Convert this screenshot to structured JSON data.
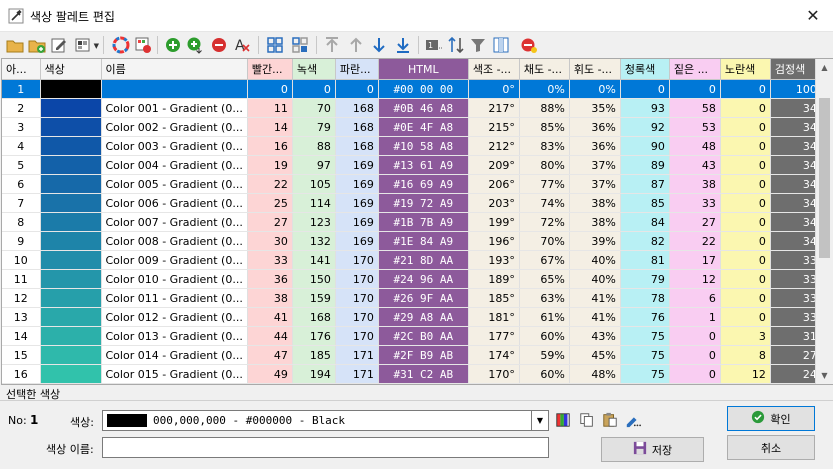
{
  "window": {
    "title": "색상 팔레트 편집"
  },
  "toolbar": {
    "icons": [
      "open-folder-icon",
      "add-folder-icon",
      "edit-palette-icon",
      "palette-menu-icon",
      "color-wheel-icon",
      "palette-settings-icon",
      "add-color-icon",
      "add-after-icon",
      "remove-color-icon",
      "clear-format-icon",
      "grid-view-icon",
      "grid-select-icon",
      "move-top-icon",
      "move-up-icon",
      "move-down-icon",
      "move-bottom-icon",
      "numbering-icon",
      "sort-icon",
      "filter-icon",
      "columns-icon",
      "stop-icon"
    ]
  },
  "grid": {
    "columns": {
      "index": "아...",
      "swatch": "색상",
      "name": "이름",
      "r": "빨간...",
      "g": "녹색",
      "b": "파란...",
      "html": "HTML",
      "hue": "색조 -...",
      "sat": "채도 -...",
      "lum": "휘도 -...",
      "c": "청록색",
      "m": "짙은 ...",
      "y": "노란색",
      "k": "검정색"
    },
    "rows": [
      {
        "i": "1",
        "name": "",
        "r": "0",
        "g": "0",
        "b": "0",
        "html": "#00 00 00",
        "hue": "0°",
        "sat": "0%",
        "lum": "0%",
        "c": "0",
        "m": "0",
        "y": "0",
        "k": "100",
        "color": "#000000"
      },
      {
        "i": "2",
        "name": "Color 001 - Gradient (0...",
        "r": "11",
        "g": "70",
        "b": "168",
        "html": "#0B 46 A8",
        "hue": "217°",
        "sat": "88%",
        "lum": "35%",
        "c": "93",
        "m": "58",
        "y": "0",
        "k": "34",
        "color": "#0B46A8"
      },
      {
        "i": "3",
        "name": "Color 002 - Gradient (0...",
        "r": "14",
        "g": "79",
        "b": "168",
        "html": "#0E 4F A8",
        "hue": "215°",
        "sat": "85%",
        "lum": "36%",
        "c": "92",
        "m": "53",
        "y": "0",
        "k": "34",
        "color": "#0E4FA8"
      },
      {
        "i": "4",
        "name": "Color 003 - Gradient (0...",
        "r": "16",
        "g": "88",
        "b": "168",
        "html": "#10 58 A8",
        "hue": "212°",
        "sat": "83%",
        "lum": "36%",
        "c": "90",
        "m": "48",
        "y": "0",
        "k": "34",
        "color": "#1058A8"
      },
      {
        "i": "5",
        "name": "Color 004 - Gradient (0...",
        "r": "19",
        "g": "97",
        "b": "169",
        "html": "#13 61 A9",
        "hue": "209°",
        "sat": "80%",
        "lum": "37%",
        "c": "89",
        "m": "43",
        "y": "0",
        "k": "34",
        "color": "#1361A9"
      },
      {
        "i": "6",
        "name": "Color 005 - Gradient (0...",
        "r": "22",
        "g": "105",
        "b": "169",
        "html": "#16 69 A9",
        "hue": "206°",
        "sat": "77%",
        "lum": "37%",
        "c": "87",
        "m": "38",
        "y": "0",
        "k": "34",
        "color": "#1669A9"
      },
      {
        "i": "7",
        "name": "Color 006 - Gradient (0...",
        "r": "25",
        "g": "114",
        "b": "169",
        "html": "#19 72 A9",
        "hue": "203°",
        "sat": "74%",
        "lum": "38%",
        "c": "85",
        "m": "33",
        "y": "0",
        "k": "34",
        "color": "#1972A9"
      },
      {
        "i": "8",
        "name": "Color 007 - Gradient (0...",
        "r": "27",
        "g": "123",
        "b": "169",
        "html": "#1B 7B A9",
        "hue": "199°",
        "sat": "72%",
        "lum": "38%",
        "c": "84",
        "m": "27",
        "y": "0",
        "k": "34",
        "color": "#1B7BA9"
      },
      {
        "i": "9",
        "name": "Color 008 - Gradient (0...",
        "r": "30",
        "g": "132",
        "b": "169",
        "html": "#1E 84 A9",
        "hue": "196°",
        "sat": "70%",
        "lum": "39%",
        "c": "82",
        "m": "22",
        "y": "0",
        "k": "34",
        "color": "#1E84A9"
      },
      {
        "i": "10",
        "name": "Color 009 - Gradient (0...",
        "r": "33",
        "g": "141",
        "b": "170",
        "html": "#21 8D AA",
        "hue": "193°",
        "sat": "67%",
        "lum": "40%",
        "c": "81",
        "m": "17",
        "y": "0",
        "k": "33",
        "color": "#218DAA"
      },
      {
        "i": "11",
        "name": "Color 010 - Gradient (0...",
        "r": "36",
        "g": "150",
        "b": "170",
        "html": "#24 96 AA",
        "hue": "189°",
        "sat": "65%",
        "lum": "40%",
        "c": "79",
        "m": "12",
        "y": "0",
        "k": "33",
        "color": "#2496AA"
      },
      {
        "i": "12",
        "name": "Color 011 - Gradient (0...",
        "r": "38",
        "g": "159",
        "b": "170",
        "html": "#26 9F AA",
        "hue": "185°",
        "sat": "63%",
        "lum": "41%",
        "c": "78",
        "m": "6",
        "y": "0",
        "k": "33",
        "color": "#269FAA"
      },
      {
        "i": "13",
        "name": "Color 012 - Gradient (0...",
        "r": "41",
        "g": "168",
        "b": "170",
        "html": "#29 A8 AA",
        "hue": "181°",
        "sat": "61%",
        "lum": "41%",
        "c": "76",
        "m": "1",
        "y": "0",
        "k": "33",
        "color": "#29A8AA"
      },
      {
        "i": "14",
        "name": "Color 013 - Gradient (0...",
        "r": "44",
        "g": "176",
        "b": "170",
        "html": "#2C B0 AA",
        "hue": "177°",
        "sat": "60%",
        "lum": "43%",
        "c": "75",
        "m": "0",
        "y": "3",
        "k": "31",
        "color": "#2CB0AA"
      },
      {
        "i": "15",
        "name": "Color 014 - Gradient (0...",
        "r": "47",
        "g": "185",
        "b": "171",
        "html": "#2F B9 AB",
        "hue": "174°",
        "sat": "59%",
        "lum": "45%",
        "c": "75",
        "m": "0",
        "y": "8",
        "k": "27",
        "color": "#2FB9AB"
      },
      {
        "i": "16",
        "name": "Color 015 - Gradient (0...",
        "r": "49",
        "g": "194",
        "b": "171",
        "html": "#31 C2 AB",
        "hue": "170°",
        "sat": "60%",
        "lum": "48%",
        "c": "75",
        "m": "0",
        "y": "12",
        "k": "24",
        "color": "#31C2AB"
      }
    ],
    "column_colors": {
      "r": "#fdd5d5",
      "g": "#d8f0d8",
      "b": "#d6e3f8",
      "html": "#8d5a9b",
      "hsl": "#f4efe4",
      "c": "#b8f0f4",
      "m": "#f9cdf2",
      "y": "#fbf7b0",
      "k": "#6e6e6e"
    }
  },
  "selected": {
    "section_label": "선택한 색상",
    "no_label": "No:",
    "no_value": "1",
    "color_label": "색상:",
    "color_value": "000,000,000 - #000000 - Black",
    "name_label": "색상 이름:",
    "name_value": ""
  },
  "buttons": {
    "ok": "확인",
    "cancel": "취소",
    "save": "저장"
  }
}
